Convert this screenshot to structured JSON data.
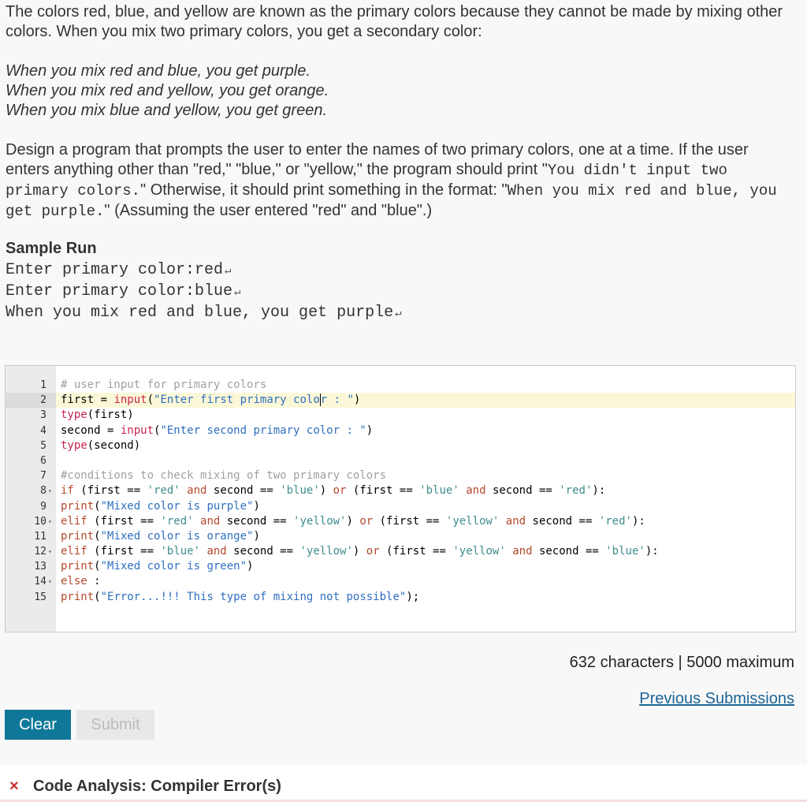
{
  "prompt": {
    "p1": "The colors red, blue, and yellow are known as the primary colors because they cannot be made by mixing other colors. When you mix two primary colors, you get a secondary color:",
    "examples": [
      "When you mix red and blue, you get purple.",
      "When you mix red and yellow, you get orange.",
      "When you mix blue and yellow, you get green."
    ],
    "p2_a": "Design a program that prompts the user to enter the names of two primary colors, one at a time. If the user enters anything other than \"red,\" \"blue,\" or \"yellow,\" the program should print \"",
    "p2_mono1": "You didn't input two primary colors.",
    "p2_b": "\" Otherwise, it should print something in the format: \"",
    "p2_mono2": "When you mix red and blue, you get purple.",
    "p2_c": "\" (Assuming the user entered \"red\" and \"blue\".)"
  },
  "sample": {
    "title": "Sample Run",
    "lines": [
      "Enter primary color:red",
      "Enter primary color:blue",
      "When you mix red and blue, you get purple"
    ],
    "return_symbol": "↵"
  },
  "editor": {
    "fold_symbol": "▾",
    "lines": [
      {
        "n": "1",
        "fold": false
      },
      {
        "n": "2",
        "fold": false,
        "active": true
      },
      {
        "n": "3",
        "fold": false
      },
      {
        "n": "4",
        "fold": false
      },
      {
        "n": "5",
        "fold": false
      },
      {
        "n": "6",
        "fold": false
      },
      {
        "n": "7",
        "fold": false
      },
      {
        "n": "8",
        "fold": true
      },
      {
        "n": "9",
        "fold": false
      },
      {
        "n": "10",
        "fold": true
      },
      {
        "n": "11",
        "fold": false
      },
      {
        "n": "12",
        "fold": true
      },
      {
        "n": "13",
        "fold": false
      },
      {
        "n": "14",
        "fold": true
      },
      {
        "n": "15",
        "fold": false
      }
    ]
  },
  "footer": {
    "char_count": "632 characters",
    "separator": "|",
    "char_max": "5000 maximum",
    "previous_submissions": "Previous Submissions",
    "clear_label": "Clear",
    "submit_label": "Submit"
  },
  "analysis": {
    "icon": "×",
    "text": "Code Analysis: Compiler Error(s)"
  },
  "colors": {
    "clear_button": "#0f7899",
    "error": "#c9302c",
    "link": "#1a6496"
  }
}
